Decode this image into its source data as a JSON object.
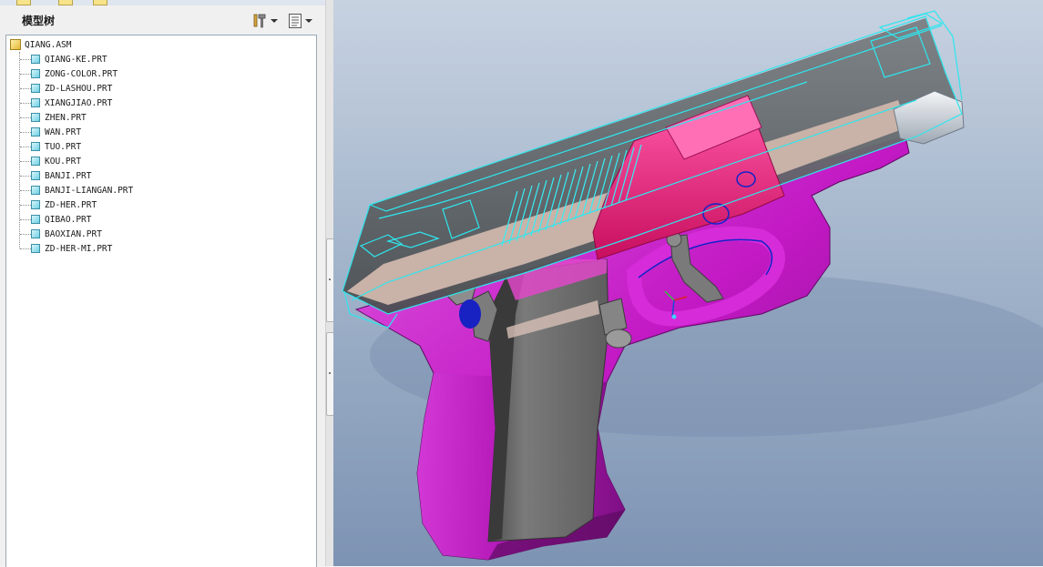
{
  "model_tree": {
    "title": "模型树",
    "root": "QIANG.ASM",
    "parts": [
      "QIANG-KE.PRT",
      "ZONG-COLOR.PRT",
      "ZD-LASHOU.PRT",
      "XIANGJIAO.PRT",
      "ZHEN.PRT",
      "WAN.PRT",
      "TUO.PRT",
      "KOU.PRT",
      "BANJI.PRT",
      "BANJI-LIANGAN.PRT",
      "ZD-HER.PRT",
      "QIBAO.PRT",
      "BAOXIAN.PRT",
      "ZD-HER-MI.PRT"
    ],
    "header_icons": [
      "settings-tools-icon",
      "tree-display-icon"
    ]
  },
  "viewport": {
    "colors": {
      "frame": "#c219c4",
      "frame_shadow": "#7d0f83",
      "slide_wire": "#2ee6ee",
      "slide_body": "#5f6468",
      "slide_lower": "#c9b2a8",
      "barrel_housing": "#e4136e",
      "magazine": "#6d6d6d",
      "accent_blue": "#1322c8",
      "background_top": "#c7d2e1",
      "background_bottom": "#7d93b3"
    }
  }
}
